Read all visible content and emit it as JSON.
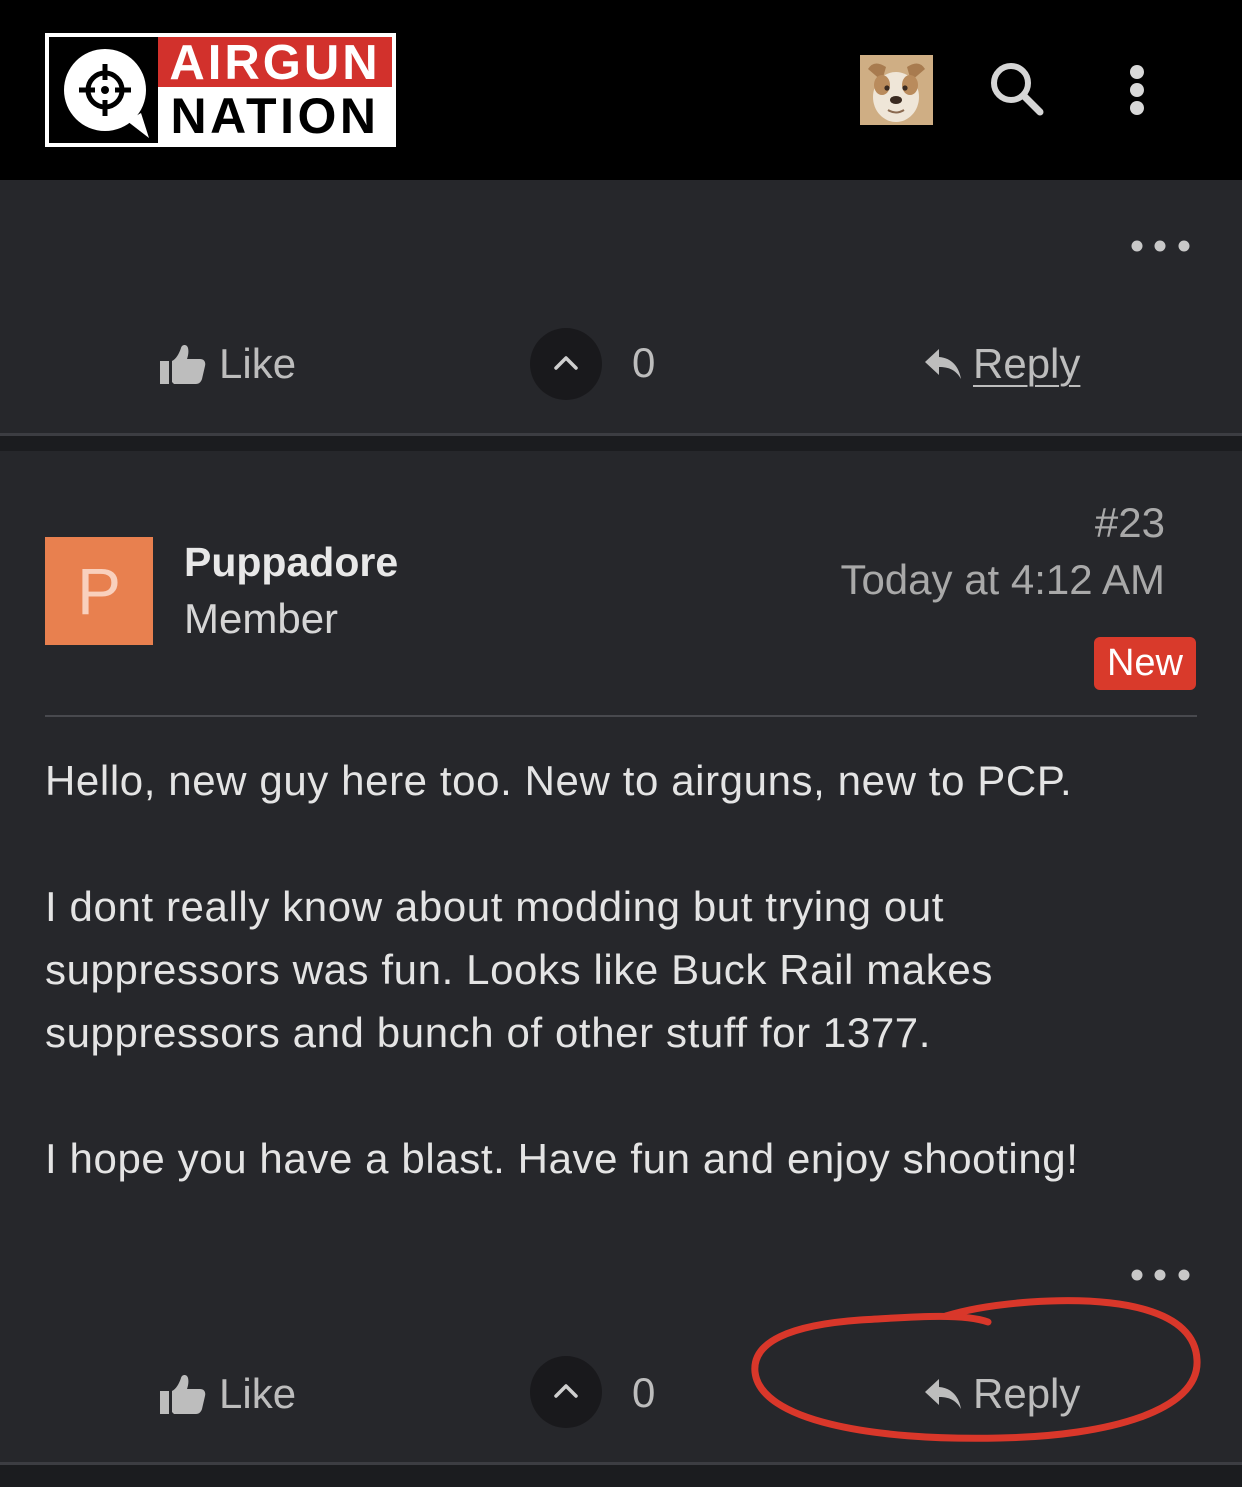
{
  "header": {
    "logo": {
      "top_text": "AIRGUN",
      "bottom_text": "NATION"
    },
    "icons": {
      "logo_mark": "crosshair-icon",
      "avatar": "user-avatar",
      "search": "search-icon",
      "menu": "more-vertical-icon"
    }
  },
  "icons": {
    "post_menu": "more-horizontal-icon",
    "like": "thumbs-up-icon",
    "vote": "chevron-up-icon",
    "reply": "reply-icon"
  },
  "colors": {
    "header_bg": "#000000",
    "content_bg": "#26272b",
    "brand_red": "#d2312c",
    "avatar_bg": "#e8804f",
    "badge_bg": "#d93a2b",
    "annotation_red": "#d9372a"
  },
  "posts": [
    {
      "actions": {
        "like_label": "Like",
        "vote_count": "0",
        "reply_label": "Reply"
      }
    },
    {
      "number": "#23",
      "timestamp": "Today at 4:12 AM",
      "badge": "New",
      "author": {
        "name": "Puppadore",
        "role": "Member",
        "avatar_letter": "P"
      },
      "body": [
        [
          "Hello, new guy here too. New to airguns, new to PCP."
        ],
        [
          "I dont really know about modding but trying out",
          "suppressors was fun. Looks like Buck Rail makes",
          "suppressors and bunch of other stuff for 1377."
        ],
        [
          "I hope you have a blast. Have fun and enjoy shooting!"
        ]
      ],
      "actions": {
        "like_label": "Like",
        "vote_count": "0",
        "reply_label": "Reply"
      }
    }
  ]
}
